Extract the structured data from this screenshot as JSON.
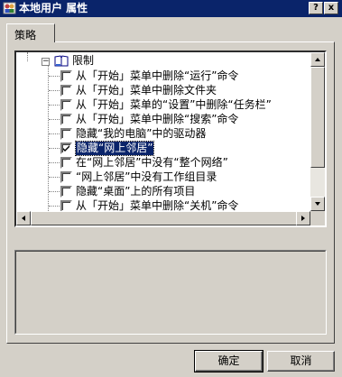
{
  "window": {
    "title": "本地用户 属性",
    "help_label": "?",
    "close_label": "x"
  },
  "tabs": [
    {
      "label": "策略",
      "active": true
    }
  ],
  "tree": {
    "parent_label": "限制",
    "items": [
      {
        "label": "从「开始」菜单中删除“运行”命令",
        "checked": false,
        "selected": false
      },
      {
        "label": "从「开始」菜单中删除文件夹",
        "checked": false,
        "selected": false
      },
      {
        "label": "从「开始」菜单的“设置”中删除“任务栏”",
        "checked": false,
        "selected": false
      },
      {
        "label": "从「开始」菜单中删除“搜索”命令",
        "checked": false,
        "selected": false
      },
      {
        "label": "隐藏“我的电脑”中的驱动器",
        "checked": false,
        "selected": false
      },
      {
        "label": "隐藏“网上邻居”",
        "checked": true,
        "selected": true
      },
      {
        "label": "在“网上邻居”中没有“整个网络”",
        "checked": false,
        "selected": false
      },
      {
        "label": "“网上邻居”中没有工作组目录",
        "checked": false,
        "selected": false
      },
      {
        "label": "隐藏“桌面”上的所有项目",
        "checked": false,
        "selected": false
      },
      {
        "label": "从「开始」菜单中删除“关机”命令",
        "checked": false,
        "selected": false
      }
    ]
  },
  "buttons": {
    "ok": "确定",
    "cancel": "取消"
  },
  "colors": {
    "titlebar": "#0a246a",
    "face": "#d4d0c8",
    "selection": "#0a246a"
  }
}
